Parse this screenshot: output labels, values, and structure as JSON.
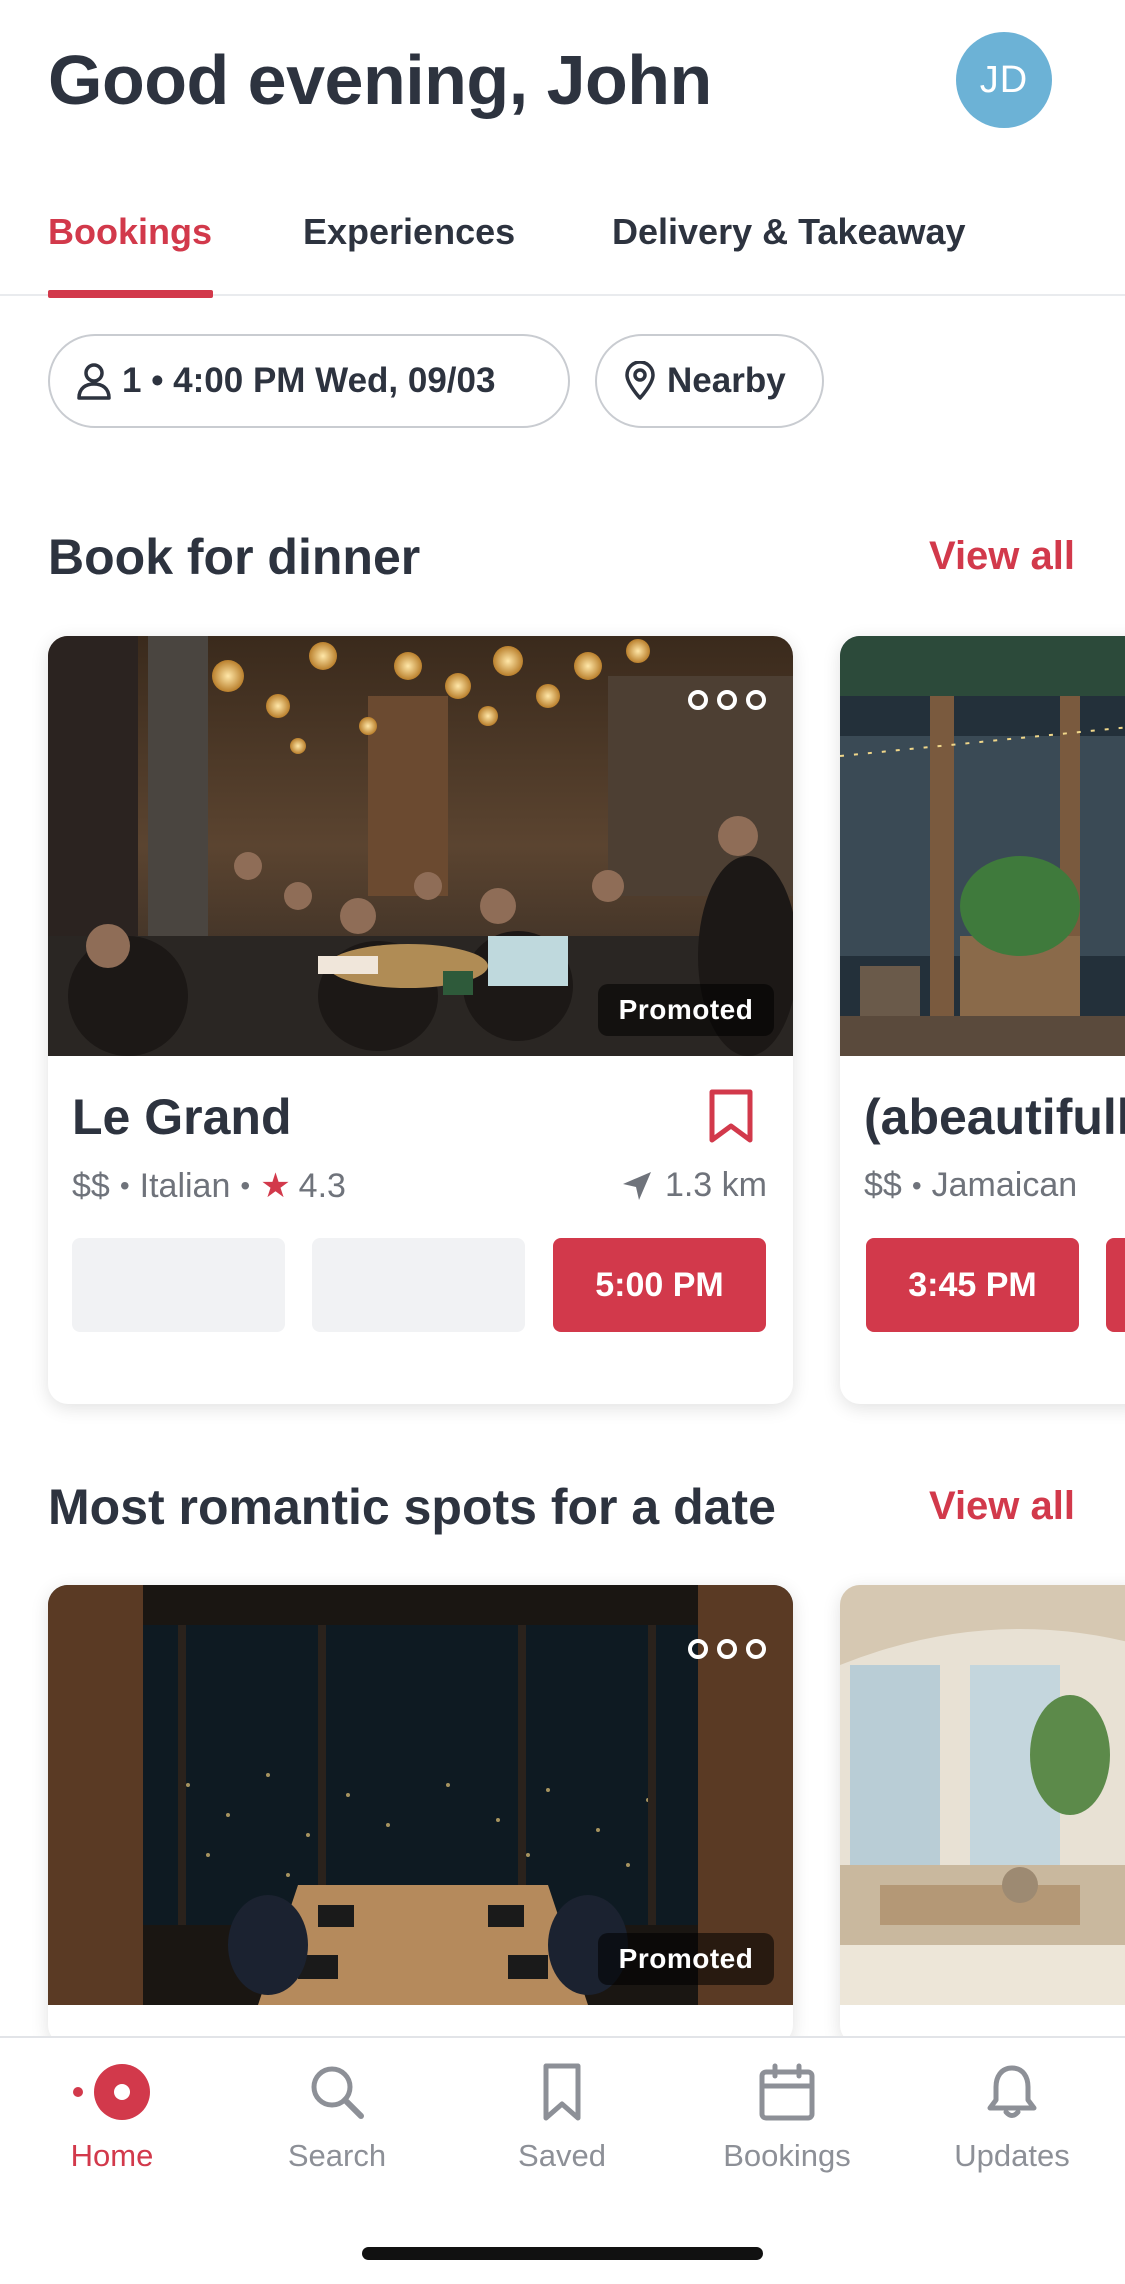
{
  "header": {
    "greeting": "Good evening, John",
    "avatar_initials": "JD",
    "avatar_color": "#6cb2d6"
  },
  "tabs": [
    {
      "label": "Bookings",
      "active": true
    },
    {
      "label": "Experiences",
      "active": false
    },
    {
      "label": "Delivery & Takeaway",
      "active": false
    }
  ],
  "filters": {
    "party": "1 • 4:00 PM Wed, 09/03",
    "location": "Nearby"
  },
  "sections": [
    {
      "title": "Book for dinner",
      "view_all": "View all",
      "cards": [
        {
          "name": "Le Grand",
          "price": "$$",
          "cuisine": "Italian",
          "rating": "4.3",
          "distance": "1.3 km",
          "promoted": "Promoted",
          "time_slot": "5:00 PM"
        },
        {
          "name": "(abeautifull",
          "price": "$$",
          "cuisine": "Jamaican",
          "time_slot": "3:45 PM"
        }
      ]
    },
    {
      "title": "Most romantic spots for a date",
      "view_all": "View all",
      "cards": [
        {
          "promoted": "Promoted"
        }
      ]
    }
  ],
  "meta_separator": "•",
  "bottom_nav": [
    {
      "label": "Home",
      "icon": "home-icon",
      "active": true
    },
    {
      "label": "Search",
      "icon": "search-icon",
      "active": false
    },
    {
      "label": "Saved",
      "icon": "bookmark-icon",
      "active": false
    },
    {
      "label": "Bookings",
      "icon": "calendar-icon",
      "active": false
    },
    {
      "label": "Updates",
      "icon": "bell-icon",
      "active": false
    }
  ],
  "colors": {
    "accent": "#d2394b",
    "text": "#2d333f",
    "muted": "#6f737b"
  }
}
